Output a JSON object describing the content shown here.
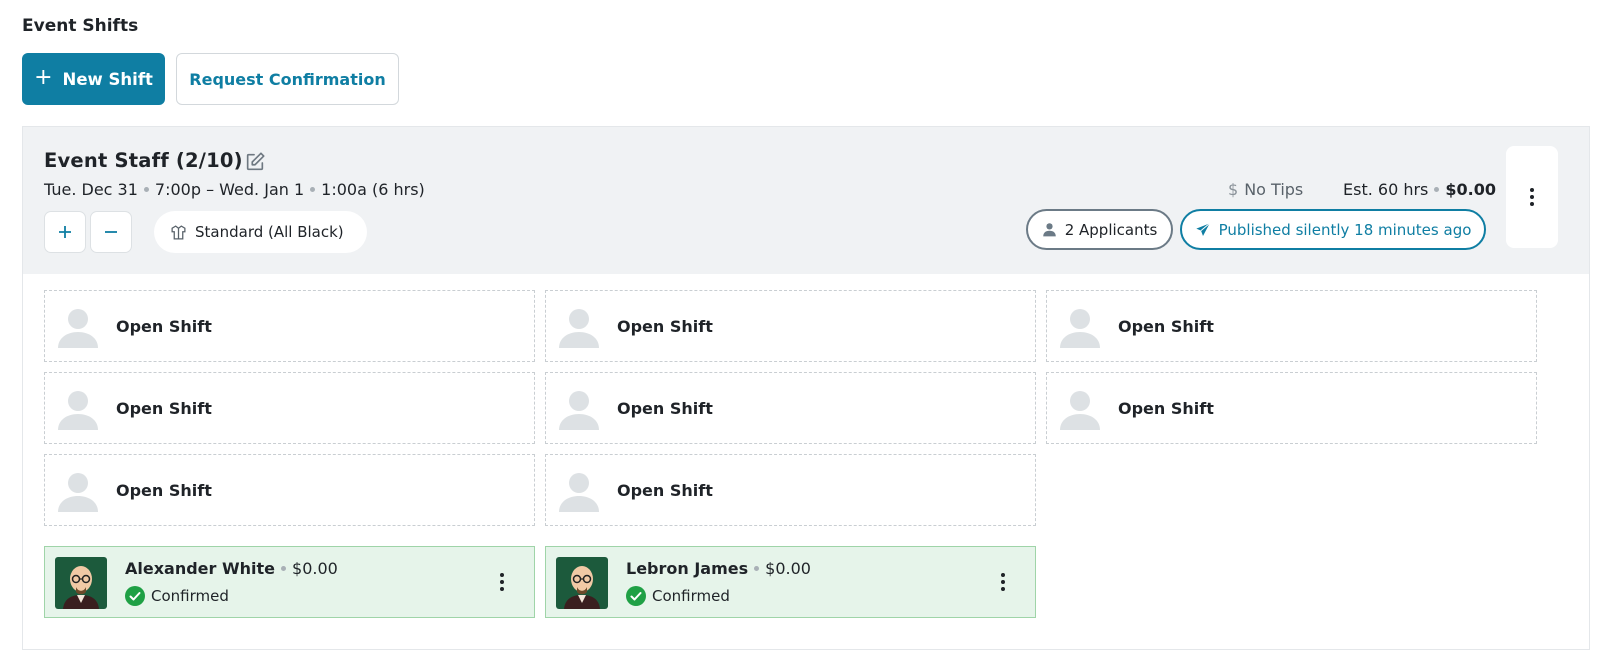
{
  "page": {
    "title": "Event Shifts"
  },
  "toolbar": {
    "new_shift_label": "New Shift",
    "request_confirmation_label": "Request Confirmation"
  },
  "group": {
    "title": "Event Staff (2/10)",
    "date_start": "Tue. Dec 31",
    "time_start": "7:00p – Wed. Jan 1",
    "time_end": "1:00a (6 hrs)",
    "attire": "Standard (All Black)",
    "tips": "No Tips",
    "est_hours": "Est. 60 hrs",
    "est_cost": "$0.00",
    "applicants": "2 Applicants",
    "published": "Published silently 18 minutes ago"
  },
  "open_shift_label": "Open Shift",
  "workers": [
    {
      "name": "Alexander White",
      "pay": "$0.00",
      "status": "Confirmed"
    },
    {
      "name": "Lebron James",
      "pay": "$0.00",
      "status": "Confirmed"
    }
  ],
  "colors": {
    "accent": "#0f7ea3",
    "confirmed_bg": "#e6f4ea",
    "confirmed_check": "#1fa045"
  },
  "icons": [
    "plus-icon",
    "edit-icon",
    "shirt-icon",
    "dollar-icon",
    "person-icon",
    "send-icon",
    "kebab-icon",
    "check-circle-icon"
  ]
}
